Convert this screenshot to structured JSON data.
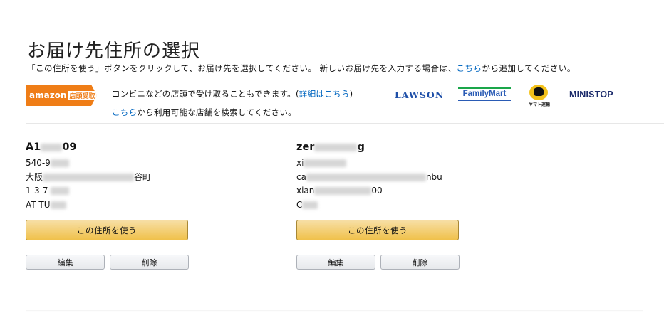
{
  "page": {
    "title": "お届け先住所の選択",
    "instruction_prefix": "「この住所を使う」ボタンをクリックして、お届け先を選択してください。 新しいお届け先を入力する場合は、",
    "instruction_link": "こちら",
    "instruction_suffix": "から追加してください。"
  },
  "pickup": {
    "badge_brand": "amazon",
    "badge_sub": "店頭受取",
    "line1_text": "コンビニなどの店頭で受け取ることもできます。(",
    "line1_link": "詳細はこちら",
    "line1_close": ")",
    "line2_link": "こちら",
    "line2_text": "から利用可能な店舗を検索してください。",
    "logos": {
      "lawson": "LAWSON",
      "familymart": "FamilyMart",
      "yamato": "ヤマト運輸",
      "ministop": "MINISTOP"
    }
  },
  "addresses": [
    {
      "name_start": "A1",
      "name_end": "09",
      "line1_start": "540-9",
      "line2_start": "大阪",
      "line2_end": "谷町",
      "line3_start": "1-3-7",
      "line4_start": "AT TU",
      "use_label": "この住所を使う",
      "edit_label": "編集",
      "delete_label": "削除"
    },
    {
      "name_start": "zer",
      "name_end": "g",
      "line1_start": "xi",
      "line2_start": "ca",
      "line2_end": "nbu",
      "line3_start": "xian",
      "line3_end": "00",
      "line4_start": "C",
      "use_label": "この住所を使う",
      "edit_label": "編集",
      "delete_label": "削除"
    }
  ]
}
